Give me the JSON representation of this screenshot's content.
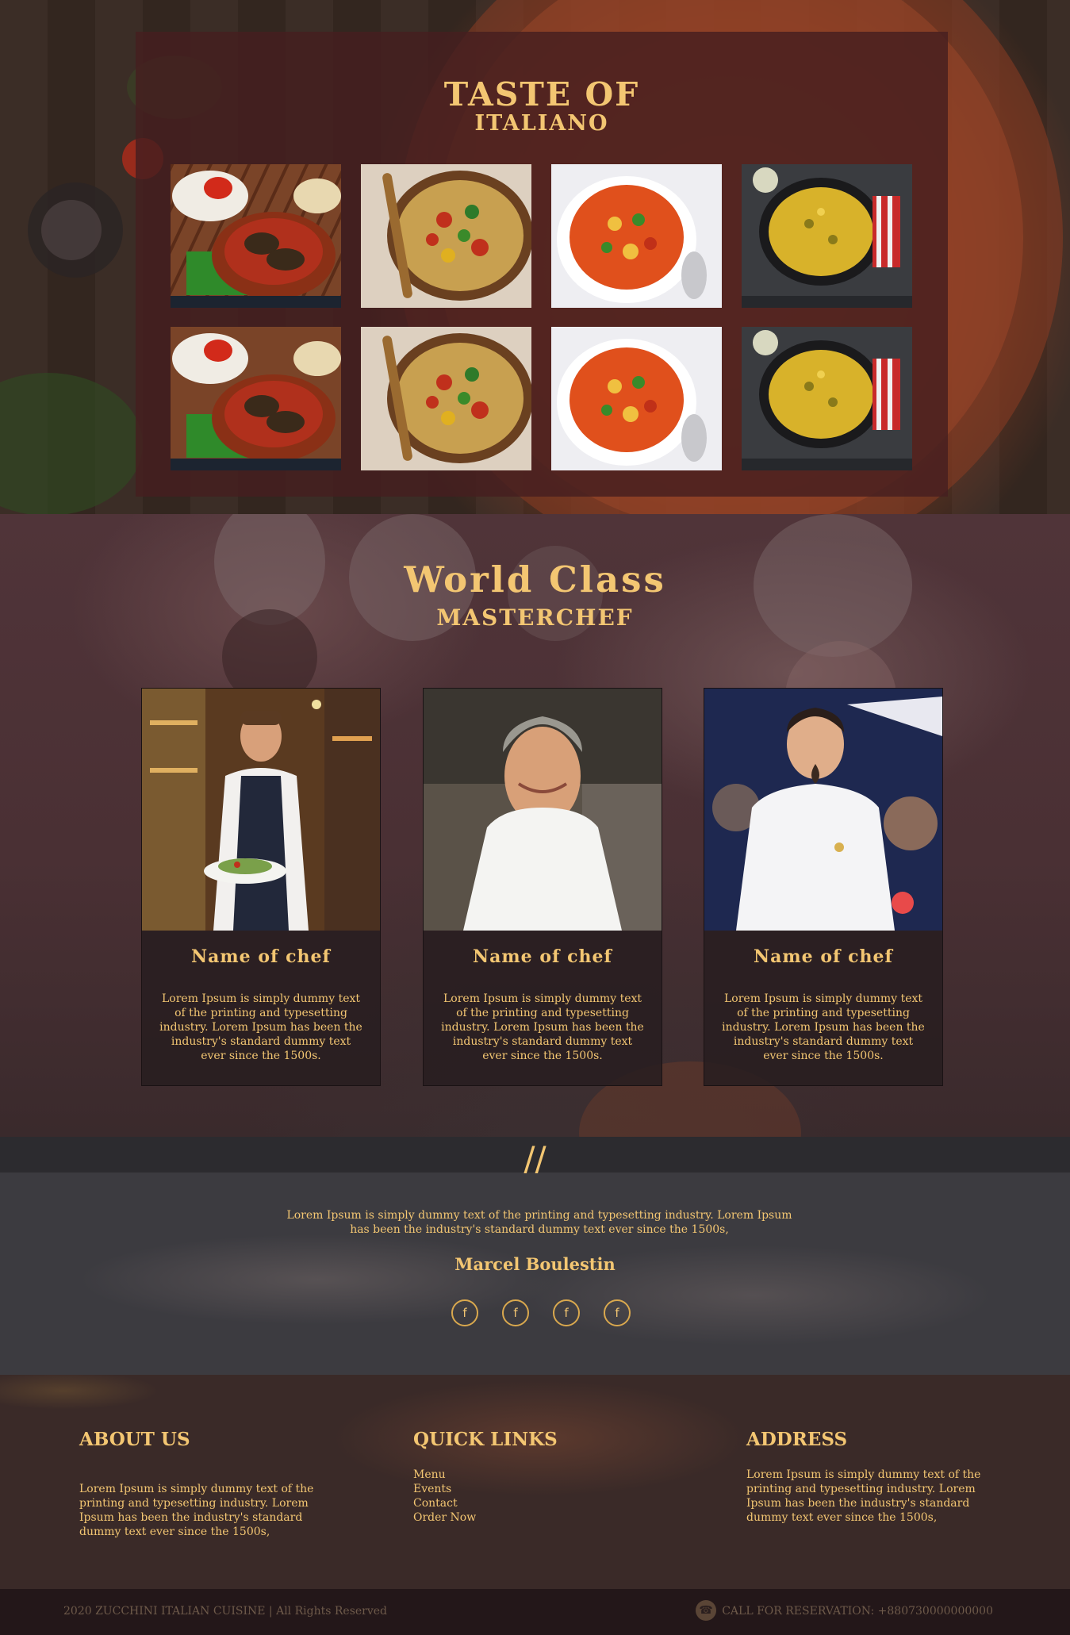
{
  "taste": {
    "title": "TASTE OF",
    "subtitle": "ITALIANO",
    "gallery": [
      {
        "alt": "stuffed-rolls-dish"
      },
      {
        "alt": "pasta-bowl"
      },
      {
        "alt": "minestrone-soup"
      },
      {
        "alt": "paella-pan"
      },
      {
        "alt": "stuffed-rolls-dish"
      },
      {
        "alt": "pasta-bowl"
      },
      {
        "alt": "minestrone-soup"
      },
      {
        "alt": "paella-pan"
      }
    ]
  },
  "chefs": {
    "title": "World Class",
    "subtitle": "MASTERCHEF",
    "cards": [
      {
        "name": "Name of chef",
        "desc": "Lorem Ipsum is simply dummy text of the printing and typesetting industry. Lorem Ipsum has been the industry's standard dummy text ever since the 1500s."
      },
      {
        "name": "Name of chef",
        "desc": "Lorem Ipsum is simply dummy text of the printing and typesetting industry. Lorem Ipsum has been the industry's standard dummy text ever since the 1500s."
      },
      {
        "name": "Name of chef",
        "desc": "Lorem Ipsum is simply dummy text of the printing and typesetting industry. Lorem Ipsum has been the industry's standard dummy text ever since the 1500s."
      }
    ]
  },
  "quote": {
    "mark": "//",
    "text": "Lorem Ipsum is simply dummy text of the printing and typesetting industry. Lorem Ipsum has been the industry's standard dummy text ever since the 1500s,",
    "author": "Marcel Boulestin",
    "social": [
      {
        "icon": "facebook-icon",
        "glyph": "f"
      },
      {
        "icon": "facebook-icon",
        "glyph": "f"
      },
      {
        "icon": "facebook-icon",
        "glyph": "f"
      },
      {
        "icon": "facebook-icon",
        "glyph": "f"
      }
    ]
  },
  "footer": {
    "about": {
      "title": "ABOUT US",
      "text": "Lorem Ipsum is simply dummy text of the printing and typesetting industry. Lorem Ipsum has been the industry's standard dummy text ever since the 1500s,"
    },
    "links": {
      "title": "QUICK LINKS",
      "items": [
        "Menu",
        "Events",
        "Contact",
        "Order Now"
      ]
    },
    "address": {
      "title": "ADDRESS",
      "text": "Lorem Ipsum is simply dummy text of the printing and typesetting industry. Lorem Ipsum has been the industry's standard dummy text ever since the 1500s,"
    },
    "copyright": "2020 ZUCCHINI ITALIAN CUISINE | All Rights Reserved",
    "reservation": "CALL FOR RESERVATION: +880730000000000",
    "phone_icon": "phone-icon"
  },
  "colors": {
    "accent": "#f3c672",
    "panel": "#461e20"
  }
}
